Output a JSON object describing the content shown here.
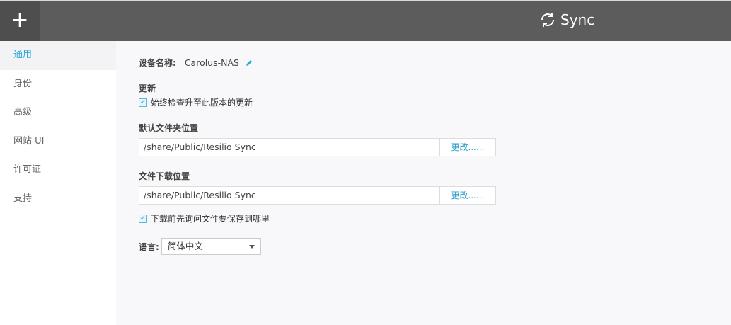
{
  "header": {
    "add_icon": "+",
    "title": "Sync"
  },
  "sidebar": {
    "items": [
      {
        "label": "通用"
      },
      {
        "label": "身份"
      },
      {
        "label": "高级"
      },
      {
        "label": "网站 UI"
      },
      {
        "label": "许可证"
      },
      {
        "label": "支持"
      }
    ]
  },
  "general": {
    "device_name_label": "设备名称:",
    "device_name": "Carolus-NAS",
    "update_label": "更新",
    "update_check": "始终检查升至此版本的更新",
    "default_folder_label": "默认文件夹位置",
    "default_folder": "/share/Public/Resilio Sync",
    "change_label": "更改......",
    "download_label": "文件下载位置",
    "download_folder": "/share/Public/Resilio Sync",
    "ask_check": "下载前先询问文件要保存到哪里",
    "language_label": "语言:",
    "language": "简体中文"
  },
  "colors": {
    "accent": "#2aa6d6",
    "header": "#5c5c5c"
  }
}
